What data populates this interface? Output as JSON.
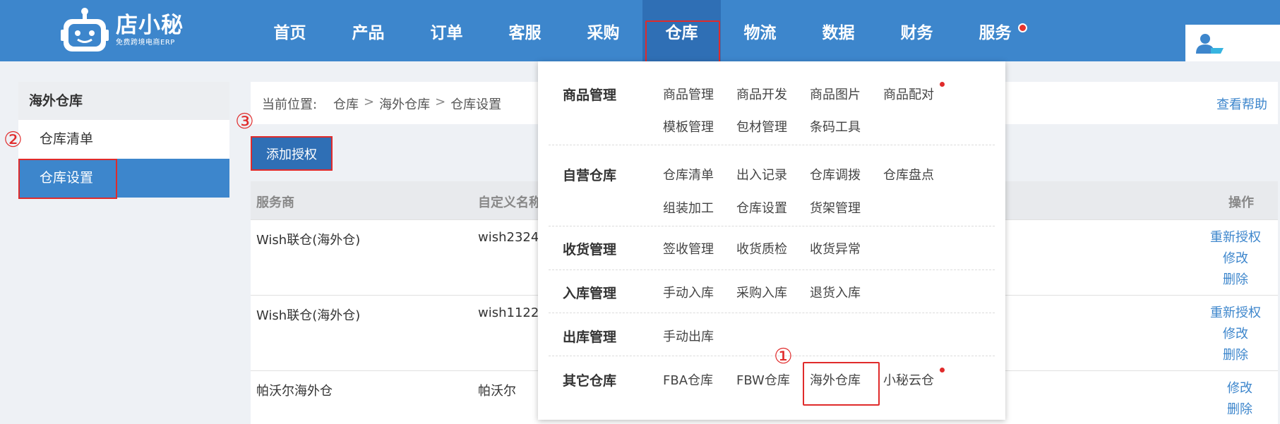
{
  "brand": {
    "name": "店小秘",
    "tagline": "免费跨境电商ERP"
  },
  "nav": {
    "items": [
      {
        "label": "首页"
      },
      {
        "label": "产品"
      },
      {
        "label": "订单"
      },
      {
        "label": "客服"
      },
      {
        "label": "采购"
      },
      {
        "label": "仓库",
        "active": true
      },
      {
        "label": "物流"
      },
      {
        "label": "数据"
      },
      {
        "label": "财务"
      },
      {
        "label": "服务",
        "badge": true
      }
    ]
  },
  "sidebar": {
    "heading": "海外仓库",
    "items": [
      {
        "label": "仓库清单"
      },
      {
        "label": "仓库设置",
        "active": true
      }
    ]
  },
  "breadcrumb": {
    "label": "当前位置:",
    "path": [
      "仓库",
      "海外仓库",
      "仓库设置"
    ],
    "separator": ">",
    "help": "查看帮助"
  },
  "toolbar": {
    "add_label": "添加授权"
  },
  "table": {
    "headers": {
      "provider": "服务商",
      "custom_name": "自定义名称",
      "actions": "操作"
    },
    "rows": [
      {
        "provider": "Wish联仓(海外仓)",
        "custom_name": "wish2324",
        "actions": [
          "重新授权",
          "修改",
          "删除"
        ]
      },
      {
        "provider": "Wish联仓(海外仓)",
        "custom_name": "wish1122",
        "actions": [
          "重新授权",
          "修改",
          "删除"
        ]
      },
      {
        "provider": "帕沃尔海外仓",
        "custom_name": "帕沃尔",
        "actions": [
          "修改",
          "删除"
        ]
      }
    ]
  },
  "dropdown": {
    "sections": [
      {
        "title": "商品管理",
        "links": [
          {
            "label": "商品管理"
          },
          {
            "label": "商品开发"
          },
          {
            "label": "商品图片"
          },
          {
            "label": "商品配对",
            "dot": true
          },
          {
            "label": "模板管理"
          },
          {
            "label": "包材管理"
          },
          {
            "label": "条码工具"
          }
        ]
      },
      {
        "title": "自营仓库",
        "links": [
          {
            "label": "仓库清单"
          },
          {
            "label": "出入记录"
          },
          {
            "label": "仓库调拨"
          },
          {
            "label": "仓库盘点"
          },
          {
            "label": "组装加工"
          },
          {
            "label": "仓库设置"
          },
          {
            "label": "货架管理"
          }
        ]
      },
      {
        "title": "收货管理",
        "links": [
          {
            "label": "签收管理"
          },
          {
            "label": "收货质检"
          },
          {
            "label": "收货异常"
          }
        ]
      },
      {
        "title": "入库管理",
        "links": [
          {
            "label": "手动入库"
          },
          {
            "label": "采购入库"
          },
          {
            "label": "退货入库"
          }
        ]
      },
      {
        "title": "出库管理",
        "links": [
          {
            "label": "手动出库"
          }
        ]
      },
      {
        "title": "其它仓库",
        "links": [
          {
            "label": "FBA仓库"
          },
          {
            "label": "FBW仓库"
          },
          {
            "label": "海外仓库",
            "highlighted": true
          },
          {
            "label": "小秘云仓",
            "dot": true
          }
        ]
      }
    ]
  },
  "annotations": {
    "step1": "①",
    "step2": "②",
    "step3": "③"
  },
  "colors": {
    "header": "#3d86cc",
    "accent": "#2f6fb5",
    "highlight": "#e02b2b",
    "link": "#3d86cc"
  },
  "icons": {
    "logo": "robot-logo-icon",
    "user": "user-card-icon"
  }
}
